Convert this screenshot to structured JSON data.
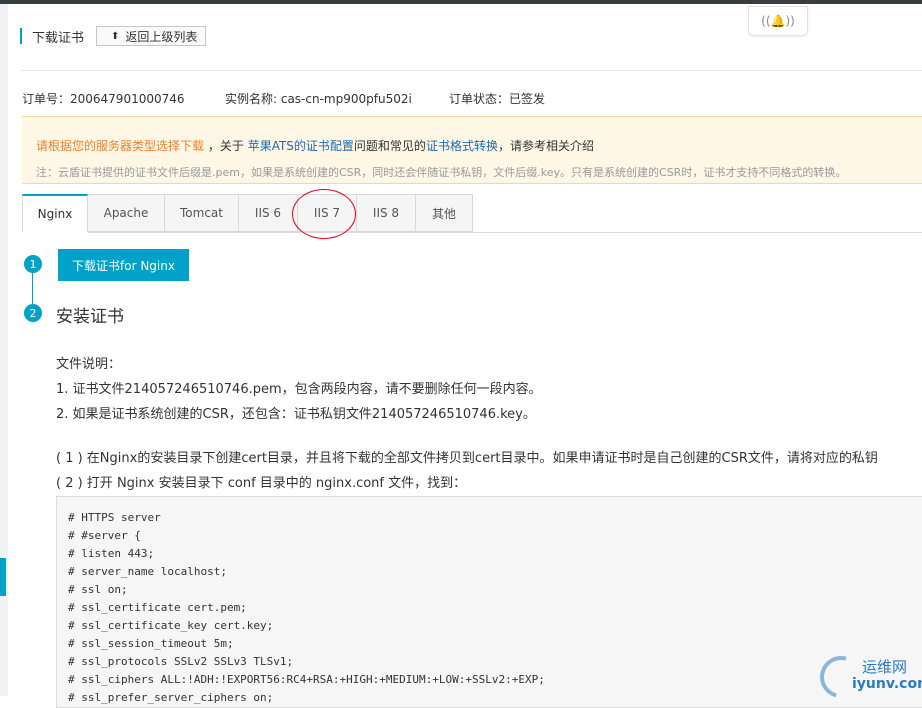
{
  "header": {
    "title": "下载证书",
    "back_label": "返回上级列表"
  },
  "order": {
    "order_no": "订单号：200647901000746",
    "instance": "实例名称: cas-cn-mp900pfu502i",
    "status": "订单状态：已签发"
  },
  "notice": {
    "warn": "请根据您的服务器类型选择下载",
    "t1": "，关于",
    "link1": "苹果ATS的证书配置",
    "t2": "问题和常见的",
    "link2": "证书格式转换",
    "t3": "，请参考相关介绍",
    "note": "注：云盾证书提供的证书文件后缀是.pem，如果是系统创建的CSR，同时还会伴随证书私钥，文件后缀.key。只有是系统创建的CSR时，证书才支持不同格式的转换。"
  },
  "tabs": [
    {
      "label": "Nginx",
      "active": true
    },
    {
      "label": "Apache"
    },
    {
      "label": "Tomcat"
    },
    {
      "label": "IIS 6"
    },
    {
      "label": "IIS 7"
    },
    {
      "label": "IIS 8"
    },
    {
      "label": "其他"
    }
  ],
  "steps": {
    "step1_no": "1",
    "download_button": "下载证书for Nginx",
    "step2_no": "2",
    "step2_title": "安装证书"
  },
  "content": {
    "file_desc": "文件说明：",
    "item1": "1. 证书文件214057246510746.pem，包含两段内容，请不要删除任何一段内容。",
    "item2": "2. 如果是证书系统创建的CSR，还包含：证书私钥文件214057246510746.key。",
    "para1": "( 1 ) 在Nginx的安装目录下创建cert目录，并且将下载的全部文件拷贝到cert目录中。如果申请证书时是自己创建的CSR文件，请将对应的私钥",
    "para2": "( 2 ) 打开 Nginx 安装目录下 conf 目录中的 nginx.conf 文件，找到："
  },
  "code_lines": [
    "# HTTPS server",
    "# #server {",
    "# listen 443;",
    "# server_name localhost;",
    "# ssl on;",
    "# ssl_certificate cert.pem;",
    "# ssl_certificate_key cert.key;",
    "# ssl_session_timeout 5m;",
    "# ssl_protocols SSLv2 SSLv3 TLSv1;",
    "# ssl_ciphers ALL:!ADH:!EXPORT56:RC4+RSA:+HIGH:+MEDIUM:+LOW:+SSLv2:+EXP;",
    "# ssl_prefer_server_ciphers on;"
  ],
  "watermark": {
    "cn": "运维网",
    "url": "iyunv.com"
  },
  "colors": {
    "accent": "#00a2ca",
    "warn": "#f0822c",
    "link": "#1c6bb0",
    "annotation": "#e5001d"
  }
}
